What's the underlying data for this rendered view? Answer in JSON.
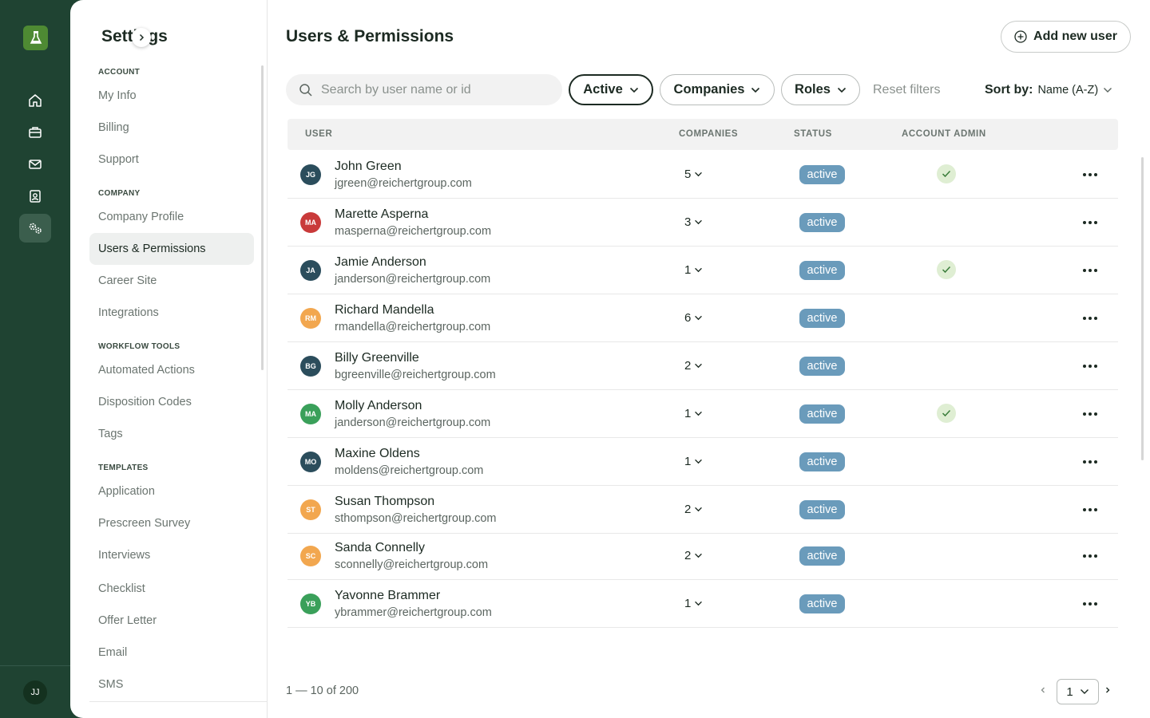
{
  "rail": {
    "items": [
      "logo-icon",
      "home-icon",
      "briefcase-icon",
      "mail-icon",
      "contact-card-icon",
      "settings-gears-icon"
    ],
    "active": "settings-gears-icon",
    "user_initials": "JJ"
  },
  "settings": {
    "title": "Settings",
    "sections": [
      {
        "label": "ACCOUNT",
        "items": [
          "My Info",
          "Billing",
          "Support"
        ]
      },
      {
        "label": "COMPANY",
        "items": [
          "Company Profile",
          "Users & Permissions",
          "Career Site",
          "Integrations"
        ]
      },
      {
        "label": "WORKFLOW TOOLS",
        "items": [
          "Automated Actions",
          "Disposition Codes",
          "Tags"
        ]
      },
      {
        "label": "TEMPLATES",
        "items": [
          "Application",
          "Prescreen Survey",
          "Interviews",
          "Checklist",
          "Offer Letter",
          "Email",
          "SMS"
        ]
      }
    ],
    "selected": "Users & Permissions"
  },
  "main": {
    "title": "Users & Permissions",
    "add_button": "Add new user",
    "search_placeholder": "Search by user name or id",
    "filters": {
      "active": "Active",
      "companies": "Companies",
      "roles": "Roles"
    },
    "reset": "Reset filters",
    "sort_label": "Sort by:",
    "sort_value": "Name (A-Z)",
    "columns": {
      "user": "USER",
      "companies": "COMPANIES",
      "status": "STATUS",
      "admin": "ACCOUNT ADMIN"
    },
    "users": [
      {
        "initials": "JG",
        "color": "#2b4d5c",
        "name": "John Green",
        "email": "jgreen@reichertgroup.com",
        "companies": "5",
        "status": "active",
        "admin": true
      },
      {
        "initials": "MA",
        "color": "#c93a3a",
        "name": "Marette Asperna",
        "email": "masperna@reichertgroup.com",
        "companies": "3",
        "status": "active",
        "admin": false
      },
      {
        "initials": "JA",
        "color": "#2b4d5c",
        "name": "Jamie Anderson",
        "email": "janderson@reichertgroup.com",
        "companies": "1",
        "status": "active",
        "admin": true
      },
      {
        "initials": "RM",
        "color": "#f2a74f",
        "name": "Richard Mandella",
        "email": "rmandella@reichertgroup.com",
        "companies": "6",
        "status": "active",
        "admin": false
      },
      {
        "initials": "BG",
        "color": "#2b4d5c",
        "name": "Billy Greenville",
        "email": "bgreenville@reichertgroup.com",
        "companies": "2",
        "status": "active",
        "admin": false
      },
      {
        "initials": "MA",
        "color": "#3aa05a",
        "name": "Molly Anderson",
        "email": "janderson@reichertgroup.com",
        "companies": "1",
        "status": "active",
        "admin": true
      },
      {
        "initials": "MO",
        "color": "#2b4d5c",
        "name": "Maxine Oldens",
        "email": "moldens@reichertgroup.com",
        "companies": "1",
        "status": "active",
        "admin": false
      },
      {
        "initials": "ST",
        "color": "#f2a74f",
        "name": "Susan Thompson",
        "email": "sthompson@reichertgroup.com",
        "companies": "2",
        "status": "active",
        "admin": false
      },
      {
        "initials": "SC",
        "color": "#f2a74f",
        "name": "Sanda Connelly",
        "email": "sconnelly@reichertgroup.com",
        "companies": "2",
        "status": "active",
        "admin": false
      },
      {
        "initials": "YB",
        "color": "#3aa05a",
        "name": "Yavonne Brammer",
        "email": "ybrammer@reichertgroup.com",
        "companies": "1",
        "status": "active",
        "admin": false
      }
    ],
    "pagination": {
      "summary": "1 — 10 of 200",
      "page": "1"
    }
  },
  "colors": {
    "rail_bg": "#1f4332",
    "status_badge": "#6a9bbb",
    "admin_check_bg": "#dfeed3"
  }
}
